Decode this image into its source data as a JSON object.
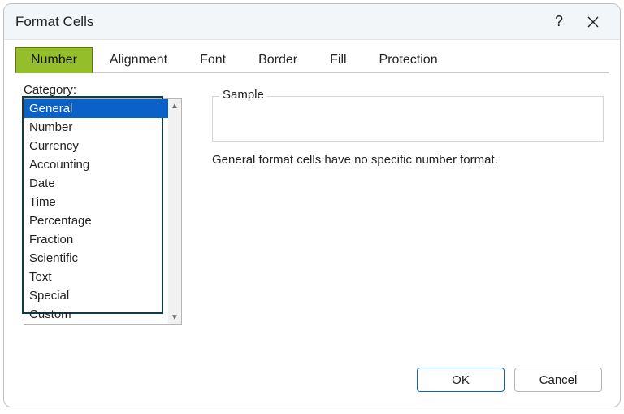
{
  "dialog": {
    "title": "Format Cells"
  },
  "tabs": {
    "number": "Number",
    "alignment": "Alignment",
    "font": "Font",
    "border": "Border",
    "fill": "Fill",
    "protection": "Protection",
    "active": "Number"
  },
  "category": {
    "label": "Category:",
    "items": [
      "General",
      "Number",
      "Currency",
      "Accounting",
      "Date",
      "Time",
      "Percentage",
      "Fraction",
      "Scientific",
      "Text",
      "Special",
      "Custom"
    ],
    "selected_index": 0
  },
  "sample": {
    "legend": "Sample",
    "value": ""
  },
  "description": "General format cells have no specific number format.",
  "buttons": {
    "ok": "OK",
    "cancel": "Cancel"
  }
}
